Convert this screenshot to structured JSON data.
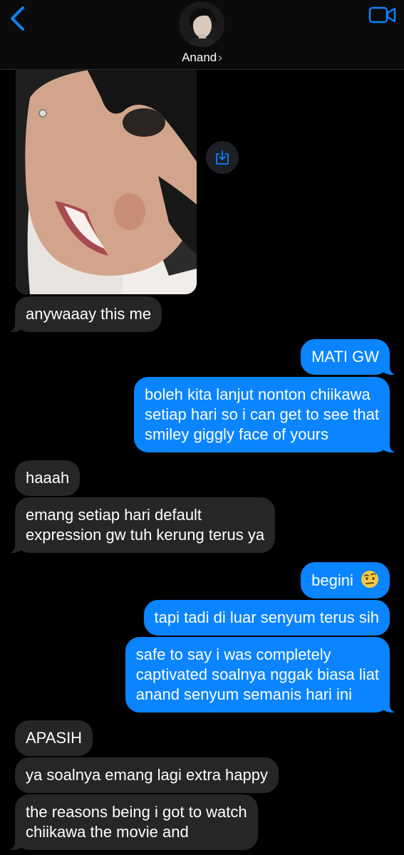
{
  "header": {
    "contact_name": "Anand",
    "chevron": "›",
    "back_icon": "chevron-left-icon",
    "video_icon": "video-camera-icon",
    "accent": "#0a84ff"
  },
  "photo_message": {
    "save_icon": "download-icon"
  },
  "colors": {
    "incoming_bubble": "#262628",
    "outgoing_bubble": "#0a84ff",
    "background": "#000000"
  },
  "messages": [
    {
      "dir": "in",
      "lines": [
        "anywaaay this me"
      ]
    },
    {
      "dir": "out",
      "lines": [
        "MATI GW"
      ]
    },
    {
      "dir": "out",
      "lines": [
        "boleh kita lanjut nonton chiikawa",
        "setiap hari so i can get to see that",
        "smiley giggly face of yours"
      ]
    },
    {
      "dir": "in",
      "lines": [
        "haaah"
      ]
    },
    {
      "dir": "in",
      "lines": [
        "emang setiap hari default",
        "expression gw tuh kerung terus ya"
      ]
    },
    {
      "dir": "out",
      "lines": [
        "begini"
      ],
      "emoji": "face-with-raised-eyebrow"
    },
    {
      "dir": "out",
      "lines": [
        "tapi tadi di luar senyum terus sih"
      ]
    },
    {
      "dir": "out",
      "lines": [
        "safe to say i was completely",
        "captivated soalnya nggak biasa liat",
        "anand senyum semanis hari ini"
      ]
    },
    {
      "dir": "in",
      "lines": [
        "APASIH"
      ]
    },
    {
      "dir": "in",
      "lines": [
        "ya soalnya emang lagi extra happy"
      ]
    },
    {
      "dir": "in",
      "lines": [
        "the reasons being i got to watch",
        "chiikawa the movie and"
      ]
    }
  ]
}
